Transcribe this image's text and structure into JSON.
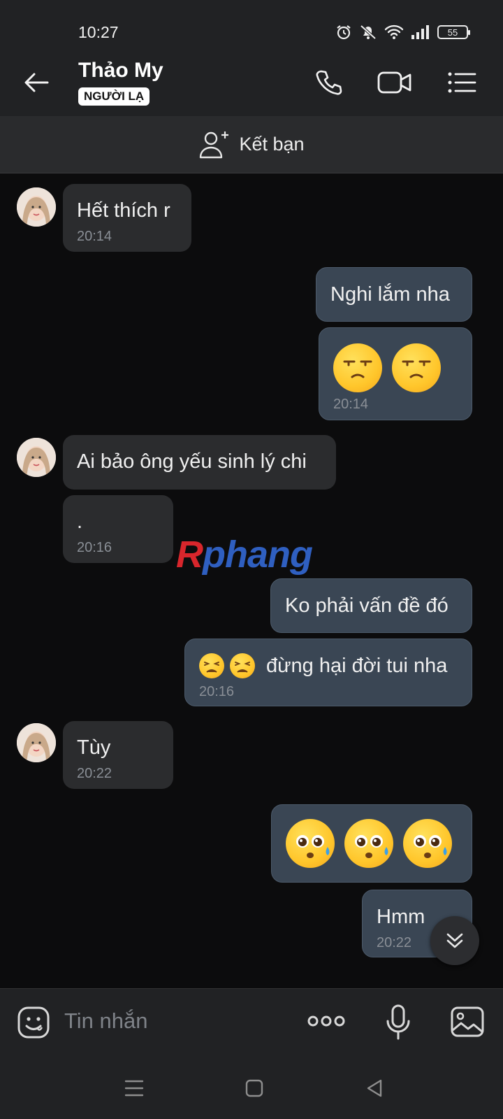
{
  "status": {
    "time": "10:27",
    "battery": "55"
  },
  "header": {
    "name": "Thảo My",
    "badge": "NGƯỜI LẠ"
  },
  "add_friend": {
    "label": "Kết bạn"
  },
  "messages": [
    {
      "side": "in",
      "text": "Hết thích r",
      "time": "20:14"
    },
    {
      "side": "out",
      "text": "Nghi lắm nha"
    },
    {
      "side": "out",
      "emoji": [
        "smirk-face",
        "smirk-face"
      ],
      "time": "20:14"
    },
    {
      "side": "in",
      "text": "Ai bảo ông yếu sinh lý chi"
    },
    {
      "side": "in",
      "text": ".",
      "time": "20:16"
    },
    {
      "side": "out",
      "text": "Ko phải vấn đề đó"
    },
    {
      "side": "out",
      "emoji": [
        "tired-face",
        "tired-face"
      ],
      "text": "đừng hại đời tui nha",
      "time": "20:16"
    },
    {
      "side": "in",
      "text": "Tùy",
      "time": "20:22"
    },
    {
      "side": "out",
      "emoji": [
        "pleading-sweat-face",
        "pleading-sweat-face",
        "pleading-sweat-face"
      ]
    },
    {
      "side": "out",
      "text": "Hmm",
      "time": "20:22"
    }
  ],
  "watermark": {
    "part1": "R",
    "part2": "phang"
  },
  "composer": {
    "placeholder": "Tin nhắn"
  },
  "colors": {
    "background": "#0c0c0d",
    "bar": "#212224",
    "incoming": "#2b2c2e",
    "outgoing": "#3a4654"
  }
}
